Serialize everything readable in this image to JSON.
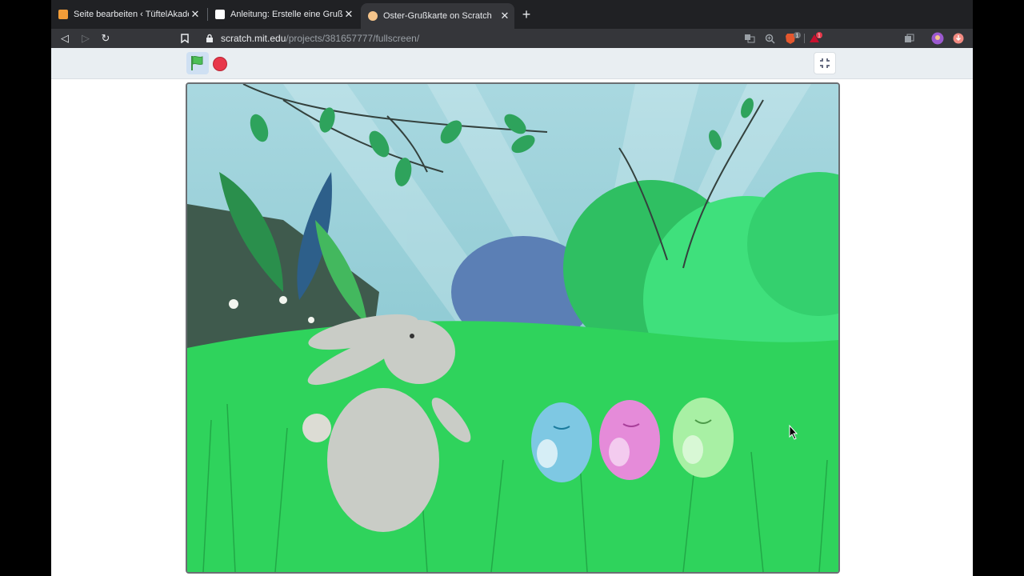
{
  "tabs": [
    {
      "title": "Seite bearbeiten ‹ TüftelAkadem",
      "favicon": "wordpress-orange-icon",
      "active": false
    },
    {
      "title": "Anleitung: Erstelle eine Grußkart",
      "favicon": "scratch-cat-icon",
      "active": false
    },
    {
      "title": "Oster-Grußkarte on Scratch",
      "favicon": "scratch-orange-icon",
      "active": true
    }
  ],
  "address": {
    "host": "scratch.mit.edu",
    "path": "/projects/381657777/fullscreen/"
  },
  "extensions": {
    "brave_badge": "1",
    "alert_badge": "1"
  },
  "stage": {
    "scene": "Easter greeting card: grey bunny in green meadow with three dancing eggs (blue, pink, light green)"
  },
  "colors": {
    "flag": "#4cbf56",
    "stop": "#e8374a",
    "grass": "#2fd35c",
    "bush": "#39e07a"
  }
}
